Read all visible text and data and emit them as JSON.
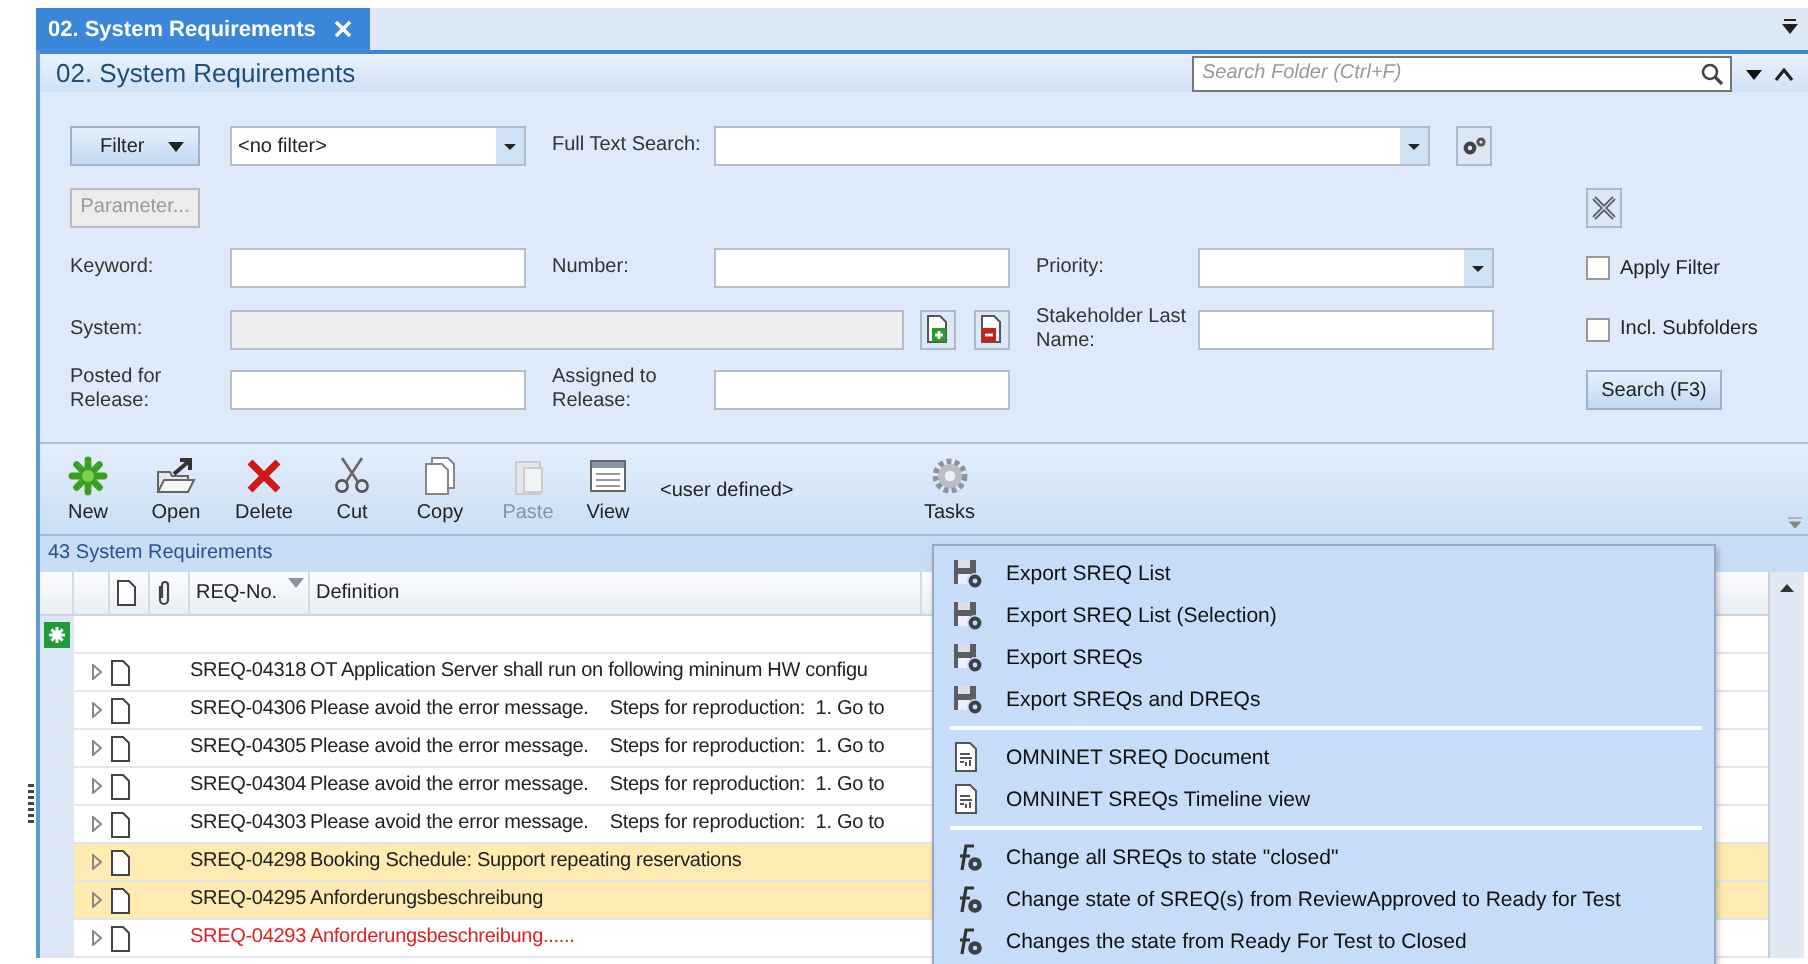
{
  "tab": {
    "label": "02. System Requirements",
    "selected": true
  },
  "panel": {
    "title": "02. System Requirements",
    "search": {
      "placeholder": "Search Folder (Ctrl+F)"
    }
  },
  "filter": {
    "filter_button": "Filter",
    "preset": "<no filter>",
    "full_text_label": "Full Text Search:",
    "parameter_button": {
      "label": "Parameter...",
      "disabled": true
    },
    "keyword": {
      "label": "Keyword:"
    },
    "number": {
      "label": "Number:"
    },
    "priority": {
      "label": "Priority:"
    },
    "system": {
      "label": "System:",
      "disabled": true
    },
    "stakeholder": {
      "label": "Stakeholder Last Name:"
    },
    "posted": {
      "label": "Posted for Release:"
    },
    "assigned": {
      "label": "Assigned to Release:"
    },
    "options": [
      {
        "label": "Apply Filter",
        "checked": false
      },
      {
        "label": "Incl. Subfolders",
        "checked": false
      }
    ],
    "search_button": "Search (F3)"
  },
  "toolbar": {
    "items": [
      {
        "label": "New",
        "kind": "new",
        "disabled": false
      },
      {
        "label": "Open",
        "kind": "open",
        "disabled": false
      },
      {
        "label": "Delete",
        "kind": "delete",
        "disabled": false
      },
      {
        "label": "Cut",
        "kind": "cut",
        "disabled": false
      },
      {
        "label": "Copy",
        "kind": "copy",
        "disabled": false
      },
      {
        "label": "Paste",
        "kind": "paste",
        "disabled": true
      },
      {
        "label": "View",
        "kind": "view",
        "disabled": false
      }
    ],
    "view_mode": "<user defined>",
    "tasks": "Tasks"
  },
  "grid": {
    "count": "43 System Requirements",
    "columns": [
      "REQ-No.",
      "Definition"
    ],
    "rows": [
      {
        "id": "SREQ-04318",
        "definition": "OT Application Server shall run on following mininum HW configu",
        "highlighted": false,
        "error": false
      },
      {
        "id": "SREQ-04306",
        "definition": "Please avoid the error message.    Steps for reproduction:  1. Go to",
        "highlighted": false,
        "error": false
      },
      {
        "id": "SREQ-04305",
        "definition": "Please avoid the error message.    Steps for reproduction:  1. Go to",
        "highlighted": false,
        "error": false
      },
      {
        "id": "SREQ-04304",
        "definition": "Please avoid the error message.    Steps for reproduction:  1. Go to",
        "highlighted": false,
        "error": false
      },
      {
        "id": "SREQ-04303",
        "definition": "Please avoid the error message.    Steps for reproduction:  1. Go to",
        "highlighted": false,
        "error": false
      },
      {
        "id": "SREQ-04298",
        "definition": "Booking Schedule: Support repeating reservations",
        "highlighted": true,
        "error": false
      },
      {
        "id": "SREQ-04295",
        "definition": "Anforderungsbeschreibung",
        "highlighted": true,
        "error": false
      },
      {
        "id": "SREQ-04293",
        "definition": "Anforderungsbeschreibung......",
        "highlighted": false,
        "error": true
      }
    ]
  },
  "tasks_menu": {
    "groups": [
      {
        "items": [
          {
            "label": "Export SREQ List",
            "kind": "export"
          },
          {
            "label": "Export SREQ List (Selection)",
            "kind": "export"
          },
          {
            "label": "Export SREQs",
            "kind": "export"
          },
          {
            "label": "Export SREQs and DREQs",
            "kind": "export"
          }
        ]
      },
      {
        "items": [
          {
            "label": "OMNINET SREQ Document",
            "kind": "document"
          },
          {
            "label": "OMNINET SREQs Timeline view",
            "kind": "document"
          }
        ]
      },
      {
        "items": [
          {
            "label": "Change all SREQs to state \"closed\"",
            "kind": "action"
          },
          {
            "label": "Change state of SREQ(s) from ReviewApproved to Ready for Test",
            "kind": "action"
          },
          {
            "label": "Changes the state from Ready For Test to Closed",
            "kind": "action"
          }
        ]
      }
    ]
  }
}
